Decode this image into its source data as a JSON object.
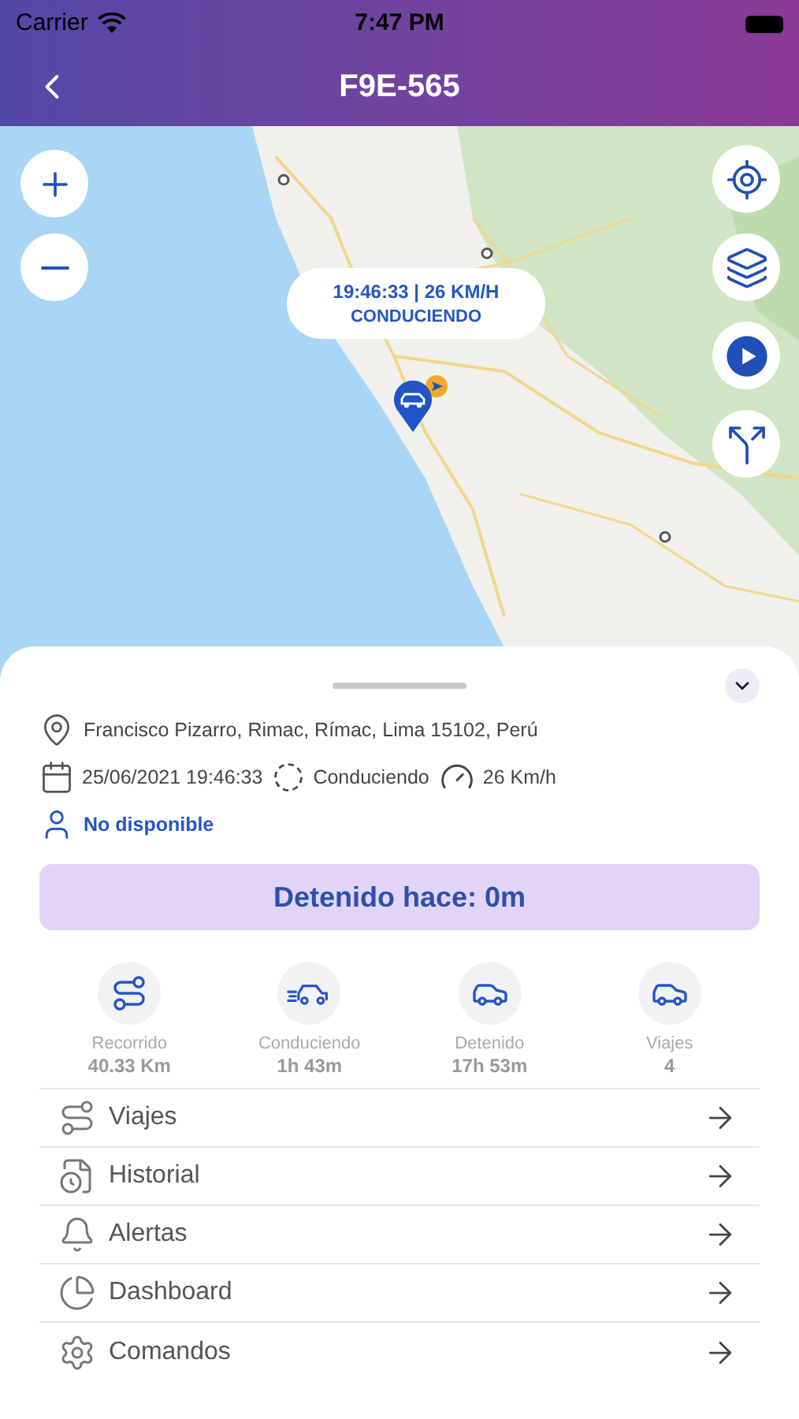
{
  "status_bar": {
    "carrier": "Carrier",
    "time": "7:47 PM"
  },
  "nav": {
    "title": "F9E-565"
  },
  "map": {
    "kind": "picture",
    "controls": [
      {
        "kind": "locate"
      },
      {
        "kind": "layers"
      },
      {
        "kind": "play"
      },
      {
        "kind": "directions"
      }
    ],
    "popup": {
      "time": "19:46:33",
      "separator": "|",
      "speed": "26 KM/H",
      "status": "CONDUCIENDO"
    }
  },
  "sheet": {
    "address": "Francisco Pizarro, Rimac, Rímac, Lima 15102, Perú",
    "date": "25/06/2021 19:46:33",
    "state": "Conduciendo",
    "speed": "26 Km/h",
    "driver": "No disponible",
    "banner": "Detenido hace: 0m",
    "stats": [
      {
        "kind": "route",
        "label": "Recorrido",
        "value": "40.33 Km"
      },
      {
        "kind": "driving",
        "label": "Conduciendo",
        "value": "1h 43m"
      },
      {
        "kind": "stopped",
        "label": "Detenido",
        "value": "17h 53m"
      },
      {
        "kind": "trips",
        "label": "Viajes",
        "value": "4"
      }
    ],
    "menu": [
      {
        "kind": "trips",
        "label": "Viajes"
      },
      {
        "kind": "history",
        "label": "Historial"
      },
      {
        "kind": "alerts",
        "label": "Alertas"
      },
      {
        "kind": "dashboard",
        "label": "Dashboard"
      },
      {
        "kind": "commands",
        "label": "Comandos"
      }
    ]
  }
}
